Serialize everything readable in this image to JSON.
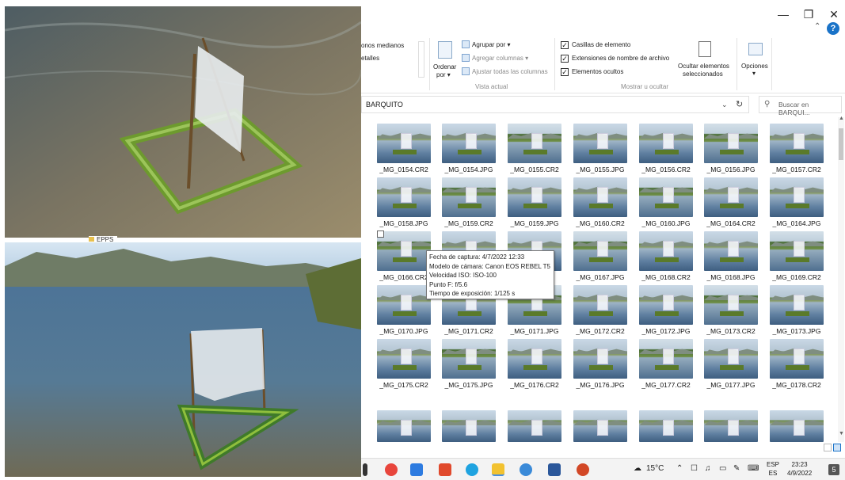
{
  "window": {
    "minimize_icon": "minimize-icon",
    "maximize_icon": "restore-icon",
    "close_icon": "close-icon",
    "help_label": "?",
    "ribbon_collapse_icon": "chevron-up-icon"
  },
  "ribbon": {
    "layout_items": [
      "onos medianos",
      "etalles"
    ],
    "sort_label_line1": "Ordenar",
    "sort_label_line2": "por",
    "group_by": "Agrupar por",
    "add_columns": "Agregar columnas",
    "fit_columns": "Ajustar todas las columnas",
    "current_view_group": "Vista actual",
    "checkboxes": [
      {
        "label": "Casillas de elemento",
        "checked": true
      },
      {
        "label": "Extensiones de nombre de archivo",
        "checked": true
      },
      {
        "label": "Elementos ocultos",
        "checked": true
      }
    ],
    "hide_selected_line1": "Ocultar elementos",
    "hide_selected_line2": "seleccionados",
    "show_hide_group": "Mostrar u ocultar",
    "options": "Opciones"
  },
  "address": {
    "path": "BARQUITO",
    "search_placeholder": "Buscar en BARQUI..."
  },
  "files": [
    [
      "_MG_0154.CR2",
      "_MG_0154.JPG",
      "_MG_0155.CR2",
      "_MG_0155.JPG",
      "_MG_0156.CR2",
      "_MG_0156.JPG",
      "_MG_0157.CR2"
    ],
    [
      "_MG_0158.JPG",
      "_MG_0159.CR2",
      "_MG_0159.JPG",
      "_MG_0160.CR2",
      "_MG_0160.JPG",
      "_MG_0164.CR2",
      "_MG_0164.JPG"
    ],
    [
      "_MG_0166.CR2",
      "",
      "",
      "_MG_0167.JPG",
      "_MG_0168.CR2",
      "_MG_0168.JPG",
      "_MG_0169.CR2"
    ],
    [
      "_MG_0170.JPG",
      "_MG_0171.CR2",
      "_MG_0171.JPG",
      "_MG_0172.CR2",
      "_MG_0172.JPG",
      "_MG_0173.CR2",
      "_MG_0173.JPG"
    ],
    [
      "_MG_0175.CR2",
      "_MG_0175.JPG",
      "_MG_0176.CR2",
      "_MG_0176.JPG",
      "_MG_0177.CR2",
      "_MG_0177.JPG",
      "_MG_0178.CR2"
    ]
  ],
  "tooltip": [
    "Fecha de captura: 4/7/2022 12:33",
    "Modelo de cámara: Canon EOS REBEL T5",
    "Velocidad ISO: ISO-100",
    "Punto F: f/5.6",
    "Tiempo de exposición: 1/125 s"
  ],
  "sidebar_folder": "EPPS",
  "taskbar": {
    "weather": "15°C",
    "lang_line1": "ESP",
    "lang_line2": "ES",
    "time": "23:23",
    "date": "4/9/2022",
    "notifications": "5"
  }
}
